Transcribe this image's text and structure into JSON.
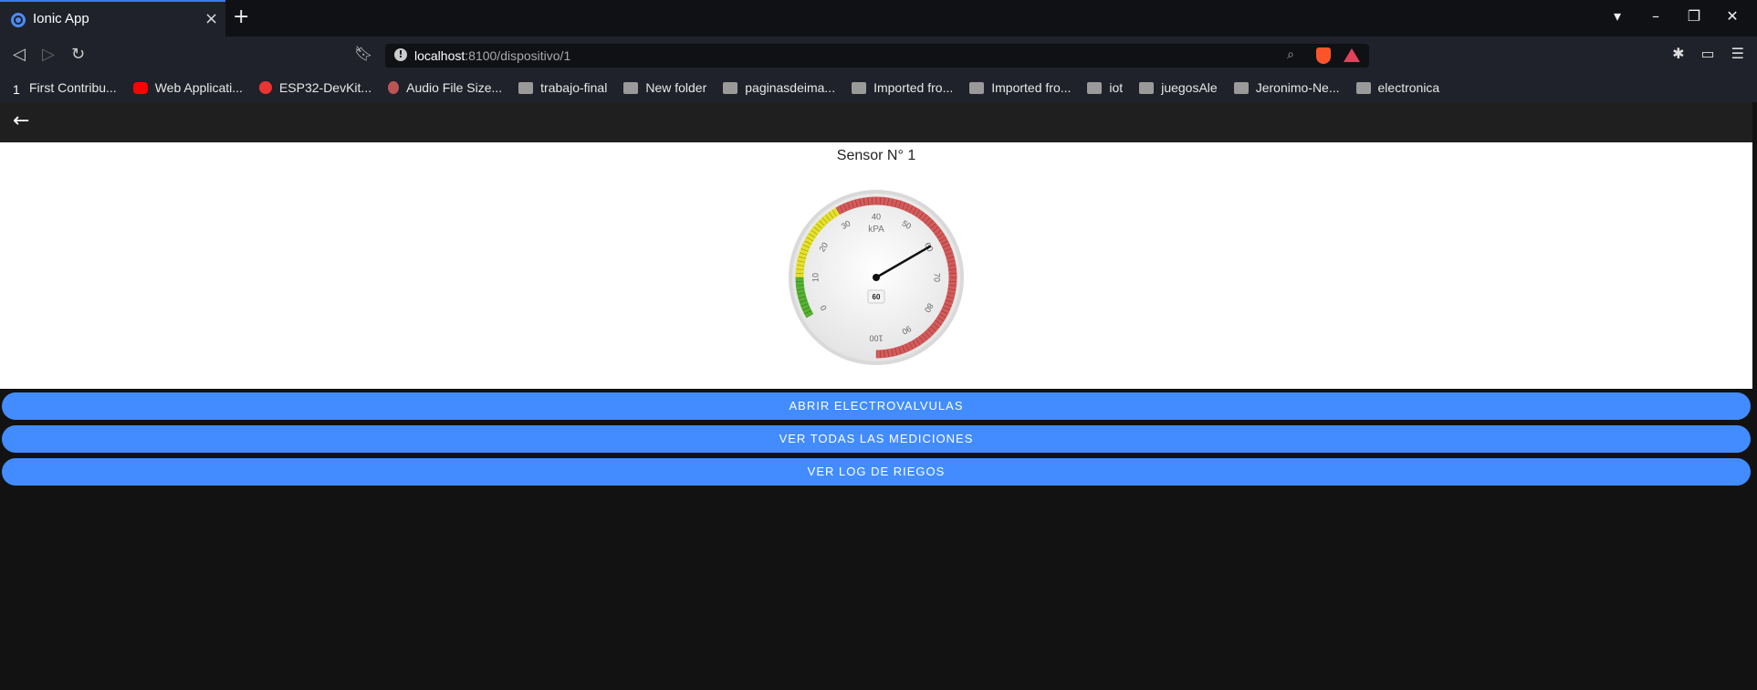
{
  "browser": {
    "tab_title": "Ionic App",
    "tab_close": "×",
    "new_tab": "+",
    "url_host": "localhost",
    "url_path": ":8100/dispositivo/1",
    "bookmarks": [
      {
        "label": "First Contribu...",
        "icon": "number-one-icon"
      },
      {
        "label": "Web Applicati...",
        "icon": "youtube-icon"
      },
      {
        "label": "ESP32-DevKit...",
        "icon": "fingerprint-icon"
      },
      {
        "label": "Audio File Size...",
        "icon": "avatar-icon"
      },
      {
        "label": "trabajo-final",
        "icon": "folder-icon"
      },
      {
        "label": "New folder",
        "icon": "folder-icon"
      },
      {
        "label": "paginasdeima...",
        "icon": "folder-icon"
      },
      {
        "label": "Imported fro...",
        "icon": "folder-icon"
      },
      {
        "label": "Imported fro...",
        "icon": "folder-icon"
      },
      {
        "label": "iot",
        "icon": "folder-icon"
      },
      {
        "label": "juegosAle",
        "icon": "folder-icon"
      },
      {
        "label": "Jeronimo-Ne...",
        "icon": "folder-icon"
      },
      {
        "label": "electronica",
        "icon": "folder-icon"
      }
    ]
  },
  "app": {
    "title": "Sensor N° 1",
    "gauge": {
      "unit": "kPA",
      "value": 60,
      "value_label": "60",
      "min": 0,
      "max": 100,
      "ticks": [
        "0",
        "10",
        "20",
        "30",
        "40",
        "50",
        "60",
        "70",
        "80",
        "90",
        "100"
      ],
      "colors": {
        "green": "#55b332",
        "yellow": "#e6e22a",
        "red": "#d65a5a"
      }
    },
    "buttons": [
      {
        "label": "ABRIR ELECTROVALVULAS"
      },
      {
        "label": "VER TODAS LAS MEDICIONES"
      },
      {
        "label": "VER LOG DE RIEGOS"
      }
    ]
  },
  "colors": {
    "primary": "#428cff",
    "header": "#1f1f1f",
    "background": "#121212"
  }
}
